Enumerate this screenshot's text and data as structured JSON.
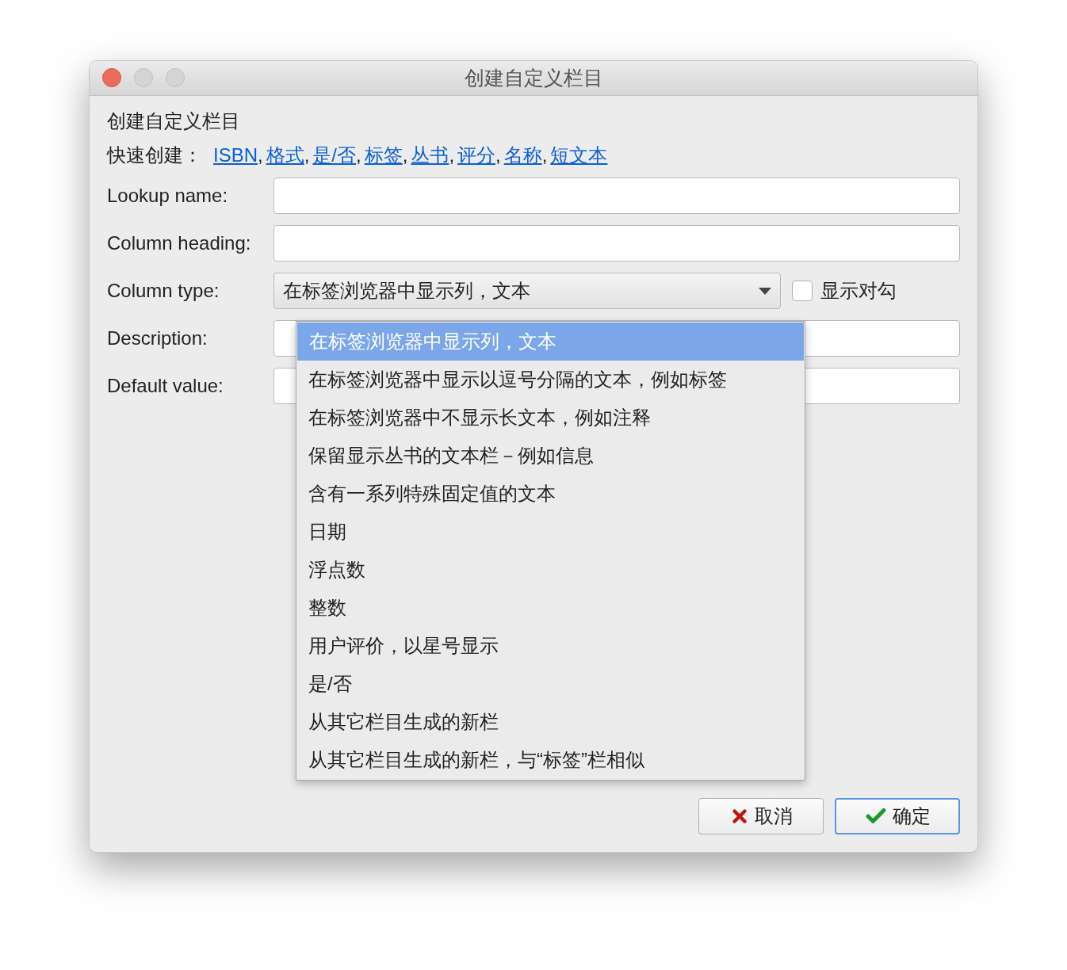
{
  "window": {
    "title": "创建自定义栏目"
  },
  "heading": "创建自定义栏目",
  "quick_create": {
    "label": "快速创建：",
    "links": [
      {
        "text": "ISBN",
        "separator": ","
      },
      {
        "text": "格式",
        "separator": ","
      },
      {
        "text": "是/否",
        "separator": ","
      },
      {
        "text": "标签",
        "separator": ","
      },
      {
        "text": "丛书",
        "separator": ","
      },
      {
        "text": "评分",
        "separator": ","
      },
      {
        "text": "名称",
        "separator": ","
      },
      {
        "text": "短文本"
      }
    ]
  },
  "fields": [
    {
      "kind": "text",
      "label": "Lookup name:"
    },
    {
      "kind": "text",
      "label": "Column heading:"
    },
    {
      "kind": "select",
      "label": "Column type:",
      "value": "在标签浏览器中显示列，文本",
      "checkbox": {
        "label": "显示对勾",
        "checked": false
      }
    },
    {
      "kind": "text",
      "label": "Description:"
    },
    {
      "kind": "text",
      "label": "Default value:"
    }
  ],
  "dropdown": {
    "expanded": true,
    "options": [
      {
        "label": "在标签浏览器中显示列，文本",
        "selected": true
      },
      {
        "label": "在标签浏览器中显示以逗号分隔的文本，例如标签",
        "selected": false
      },
      {
        "label": "在标签浏览器中不显示长文本，例如注释",
        "selected": false
      },
      {
        "label": "保留显示丛书的文本栏－例如信息",
        "selected": false
      },
      {
        "label": "含有一系列特殊固定值的文本",
        "selected": false
      },
      {
        "label": "日期",
        "selected": false
      },
      {
        "label": "浮点数",
        "selected": false
      },
      {
        "label": "整数",
        "selected": false
      },
      {
        "label": "用户评价，以星号显示",
        "selected": false
      },
      {
        "label": "是/否",
        "selected": false
      },
      {
        "label": "从其它栏目生成的新栏",
        "selected": false
      },
      {
        "label": "从其它栏目生成的新栏，与“标签”栏相似",
        "selected": false
      }
    ]
  },
  "buttons": [
    {
      "kind": "cancel",
      "label": "取消"
    },
    {
      "kind": "ok",
      "label": "确定"
    }
  ]
}
